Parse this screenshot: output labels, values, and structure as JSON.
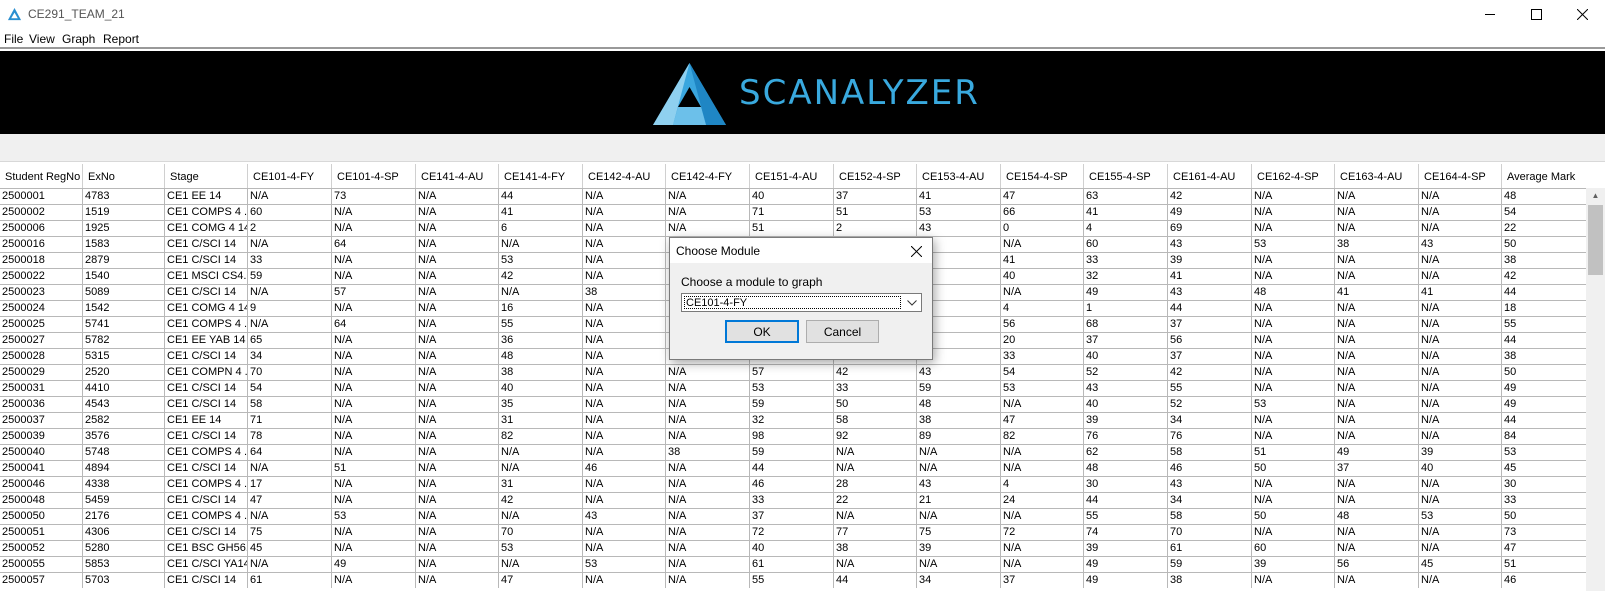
{
  "window": {
    "title": "CE291_TEAM_21"
  },
  "menu": [
    "File",
    "View",
    "Graph",
    "Report"
  ],
  "banner": {
    "logo_text": "SCANALYZER"
  },
  "table": {
    "columns": [
      "Student RegNo",
      "ExNo",
      "Stage",
      "CE101-4-FY",
      "CE101-4-SP",
      "CE141-4-AU",
      "CE141-4-FY",
      "CE142-4-AU",
      "CE142-4-FY",
      "CE151-4-AU",
      "CE152-4-SP",
      "CE153-4-AU",
      "CE154-4-SP",
      "CE155-4-SP",
      "CE161-4-AU",
      "CE162-4-SP",
      "CE163-4-AU",
      "CE164-4-SP",
      "Average Mark"
    ],
    "rows": [
      [
        "2500001",
        "4783",
        "CE1 EE      14",
        "N/A",
        "73",
        "N/A",
        "44",
        "N/A",
        "N/A",
        "40",
        "37",
        "41",
        "47",
        "63",
        "42",
        "N/A",
        "N/A",
        "N/A",
        "48"
      ],
      [
        "2500002",
        "1519",
        "CE1 COMPS 4 ...",
        "60",
        "N/A",
        "N/A",
        "41",
        "N/A",
        "N/A",
        "71",
        "51",
        "53",
        "66",
        "41",
        "49",
        "N/A",
        "N/A",
        "N/A",
        "54"
      ],
      [
        "2500006",
        "1925",
        "CE1  COMG 4 14",
        "2",
        "N/A",
        "N/A",
        "6",
        "N/A",
        "N/A",
        "51",
        "2",
        "43",
        "0",
        "4",
        "69",
        "N/A",
        "N/A",
        "N/A",
        "22"
      ],
      [
        "2500016",
        "1583",
        "CE1 C/SCI   14",
        "N/A",
        "64",
        "N/A",
        "N/A",
        "N/A",
        "",
        "",
        "",
        "",
        "N/A",
        "60",
        "43",
        "53",
        "38",
        "43",
        "50"
      ],
      [
        "2500018",
        "2879",
        "CE1 C/SCI   14",
        "33",
        "N/A",
        "N/A",
        "53",
        "N/A",
        "",
        "",
        "",
        "",
        "41",
        "33",
        "39",
        "N/A",
        "N/A",
        "N/A",
        "38"
      ],
      [
        "2500022",
        "1540",
        "CE1 MSCI CS4...",
        "59",
        "N/A",
        "N/A",
        "42",
        "N/A",
        "",
        "",
        "",
        "",
        "40",
        "32",
        "41",
        "N/A",
        "N/A",
        "N/A",
        "42"
      ],
      [
        "2500023",
        "5089",
        "CE1 C/SCI   14",
        "N/A",
        "57",
        "N/A",
        "N/A",
        "38",
        "",
        "",
        "",
        "",
        "N/A",
        "49",
        "43",
        "48",
        "41",
        "41",
        "44"
      ],
      [
        "2500024",
        "1542",
        "CE1  COMG 4 14",
        "9",
        "N/A",
        "N/A",
        "16",
        "N/A",
        "",
        "",
        "",
        "",
        "4",
        "1",
        "44",
        "N/A",
        "N/A",
        "N/A",
        "18"
      ],
      [
        "2500025",
        "5741",
        "CE1 COMPS 4 ...",
        "N/A",
        "64",
        "N/A",
        "55",
        "N/A",
        "",
        "",
        "",
        "",
        "56",
        "68",
        "37",
        "N/A",
        "N/A",
        "N/A",
        "55"
      ],
      [
        "2500027",
        "5782",
        "CE1 EE YAB  14",
        "65",
        "N/A",
        "N/A",
        "36",
        "N/A",
        "",
        "",
        "",
        "",
        "20",
        "37",
        "56",
        "N/A",
        "N/A",
        "N/A",
        "44"
      ],
      [
        "2500028",
        "5315",
        "CE1 C/SCI   14",
        "34",
        "N/A",
        "N/A",
        "48",
        "N/A",
        "",
        "",
        "",
        "",
        "33",
        "40",
        "37",
        "N/A",
        "N/A",
        "N/A",
        "38"
      ],
      [
        "2500029",
        "2520",
        "CE1 COMPN 4 ...",
        "70",
        "N/A",
        "N/A",
        "38",
        "N/A",
        "N/A",
        "57",
        "42",
        "43",
        "54",
        "52",
        "42",
        "N/A",
        "N/A",
        "N/A",
        "50"
      ],
      [
        "2500031",
        "4410",
        "CE1 C/SCI   14",
        "54",
        "N/A",
        "N/A",
        "40",
        "N/A",
        "N/A",
        "53",
        "33",
        "59",
        "53",
        "43",
        "55",
        "N/A",
        "N/A",
        "N/A",
        "49"
      ],
      [
        "2500036",
        "4543",
        "CE1 C/SCI   14",
        "58",
        "N/A",
        "N/A",
        "35",
        "N/A",
        "N/A",
        "59",
        "50",
        "48",
        "N/A",
        "40",
        "52",
        "53",
        "N/A",
        "N/A",
        "49"
      ],
      [
        "2500037",
        "2582",
        "CE1 EE      14",
        "71",
        "N/A",
        "N/A",
        "31",
        "N/A",
        "N/A",
        "32",
        "58",
        "38",
        "47",
        "39",
        "34",
        "N/A",
        "N/A",
        "N/A",
        "44"
      ],
      [
        "2500039",
        "3576",
        "CE1 C/SCI   14",
        "78",
        "N/A",
        "N/A",
        "82",
        "N/A",
        "N/A",
        "98",
        "92",
        "89",
        "82",
        "76",
        "76",
        "N/A",
        "N/A",
        "N/A",
        "84"
      ],
      [
        "2500040",
        "5748",
        "CE1 COMPS 4 ...",
        "64",
        "N/A",
        "N/A",
        "N/A",
        "N/A",
        "38",
        "59",
        "N/A",
        "N/A",
        "N/A",
        "62",
        "58",
        "51",
        "49",
        "39",
        "53"
      ],
      [
        "2500041",
        "4894",
        "CE1 C/SCI   14",
        "N/A",
        "51",
        "N/A",
        "N/A",
        "46",
        "N/A",
        "44",
        "N/A",
        "N/A",
        "N/A",
        "48",
        "46",
        "50",
        "37",
        "40",
        "45"
      ],
      [
        "2500046",
        "4338",
        "CE1 COMPS 4 ...",
        "17",
        "N/A",
        "N/A",
        "31",
        "N/A",
        "N/A",
        "46",
        "28",
        "43",
        "4",
        "30",
        "43",
        "N/A",
        "N/A",
        "N/A",
        "30"
      ],
      [
        "2500048",
        "5459",
        "CE1 C/SCI   14",
        "47",
        "N/A",
        "N/A",
        "42",
        "N/A",
        "N/A",
        "33",
        "22",
        "21",
        "24",
        "44",
        "34",
        "N/A",
        "N/A",
        "N/A",
        "33"
      ],
      [
        "2500050",
        "2176",
        "CE1 COMPS 4 ...",
        "N/A",
        "53",
        "N/A",
        "N/A",
        "43",
        "N/A",
        "37",
        "N/A",
        "N/A",
        "N/A",
        "55",
        "58",
        "50",
        "48",
        "53",
        "50"
      ],
      [
        "2500051",
        "4306",
        "CE1 C/SCI   14",
        "75",
        "N/A",
        "N/A",
        "70",
        "N/A",
        "N/A",
        "72",
        "77",
        "75",
        "72",
        "74",
        "70",
        "N/A",
        "N/A",
        "N/A",
        "73"
      ],
      [
        "2500052",
        "5280",
        "CE1 BSC GH56...",
        "45",
        "N/A",
        "N/A",
        "53",
        "N/A",
        "N/A",
        "40",
        "38",
        "39",
        "N/A",
        "39",
        "61",
        "60",
        "N/A",
        "N/A",
        "47"
      ],
      [
        "2500055",
        "5853",
        "CE1 C/SCI YA14",
        "N/A",
        "49",
        "N/A",
        "N/A",
        "53",
        "N/A",
        "61",
        "N/A",
        "N/A",
        "N/A",
        "49",
        "59",
        "39",
        "56",
        "45",
        "51"
      ],
      [
        "2500057",
        "5703",
        "CE1 C/SCI   14",
        "61",
        "N/A",
        "N/A",
        "47",
        "N/A",
        "N/A",
        "55",
        "44",
        "34",
        "37",
        "49",
        "38",
        "N/A",
        "N/A",
        "N/A",
        "46"
      ]
    ]
  },
  "dialog": {
    "title": "Choose Module",
    "prompt": "Choose a module to graph",
    "selected": "CE101-4-FY",
    "ok": "OK",
    "cancel": "Cancel"
  }
}
